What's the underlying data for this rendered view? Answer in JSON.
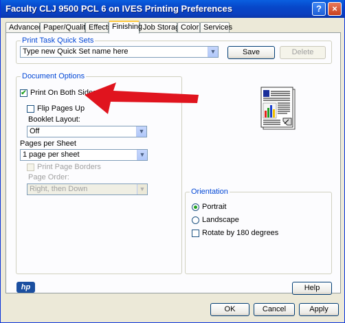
{
  "window": {
    "title": "Faculty CLJ 9500 PCL 6 on IVES Printing Preferences",
    "help_icon_glyph": "?",
    "close_icon_glyph": "×"
  },
  "tabs": [
    "Advanced",
    "Paper/Quality",
    "Effects",
    "Finishing",
    "Job Storage",
    "Color",
    "Services"
  ],
  "active_tab": "Finishing",
  "quick_sets": {
    "group_label": "Print Task Quick Sets",
    "value": "Type new Quick Set name here",
    "save_label": "Save",
    "delete_label": "Delete"
  },
  "document_options": {
    "group_label": "Document Options",
    "print_both_sides": {
      "label": "Print On Both Sides",
      "checked": true
    },
    "flip_pages_up": {
      "label": "Flip Pages Up",
      "checked": false
    },
    "booklet_layout_label": "Booklet Layout:",
    "booklet_layout_value": "Off",
    "pages_per_sheet_label": "Pages per Sheet",
    "pages_per_sheet_value": "1 page per sheet",
    "print_page_borders": {
      "label": "Print Page Borders",
      "checked": false
    },
    "page_order_label": "Page Order:",
    "page_order_value": "Right, then Down"
  },
  "orientation": {
    "group_label": "Orientation",
    "portrait_label": "Portrait",
    "landscape_label": "Landscape",
    "rotate_label": "Rotate by 180 degrees",
    "selected": "Portrait"
  },
  "logo_text": "hp",
  "footer": {
    "help_label": "Help",
    "ok_label": "OK",
    "cancel_label": "Cancel",
    "apply_label": "Apply"
  },
  "dropdown_arrow_glyph": "▼",
  "check_glyph": "✔",
  "colors": {
    "titlebar": "#0747c9",
    "group_label": "#0046d5",
    "annotation_arrow": "#e0141e",
    "dialog_bg": "#ece9d8"
  }
}
